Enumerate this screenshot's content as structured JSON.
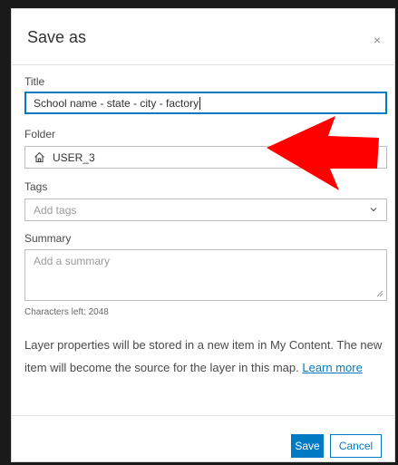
{
  "dialog": {
    "title": "Save as",
    "close_glyph": "×"
  },
  "title_field": {
    "label": "Title",
    "value": "School name - state - city - factory"
  },
  "folder_field": {
    "label": "Folder",
    "value": "USER_3",
    "icon": "home-icon"
  },
  "tags_field": {
    "label": "Tags",
    "placeholder": "Add tags"
  },
  "summary_field": {
    "label": "Summary",
    "placeholder": "Add a summary",
    "chars_left": "Characters left: 2048"
  },
  "info": {
    "text": "Layer properties will be stored in a new item in My Content. The new item will become the source for the layer in this map. ",
    "link": "Learn more"
  },
  "buttons": {
    "save": "Save",
    "cancel": "Cancel"
  },
  "annotation": {
    "arrow_color": "#ff0000",
    "arrow_icon": "red-arrow-icon"
  },
  "colors": {
    "accent": "#007ac2",
    "backdrop": "#1a1a1a"
  }
}
